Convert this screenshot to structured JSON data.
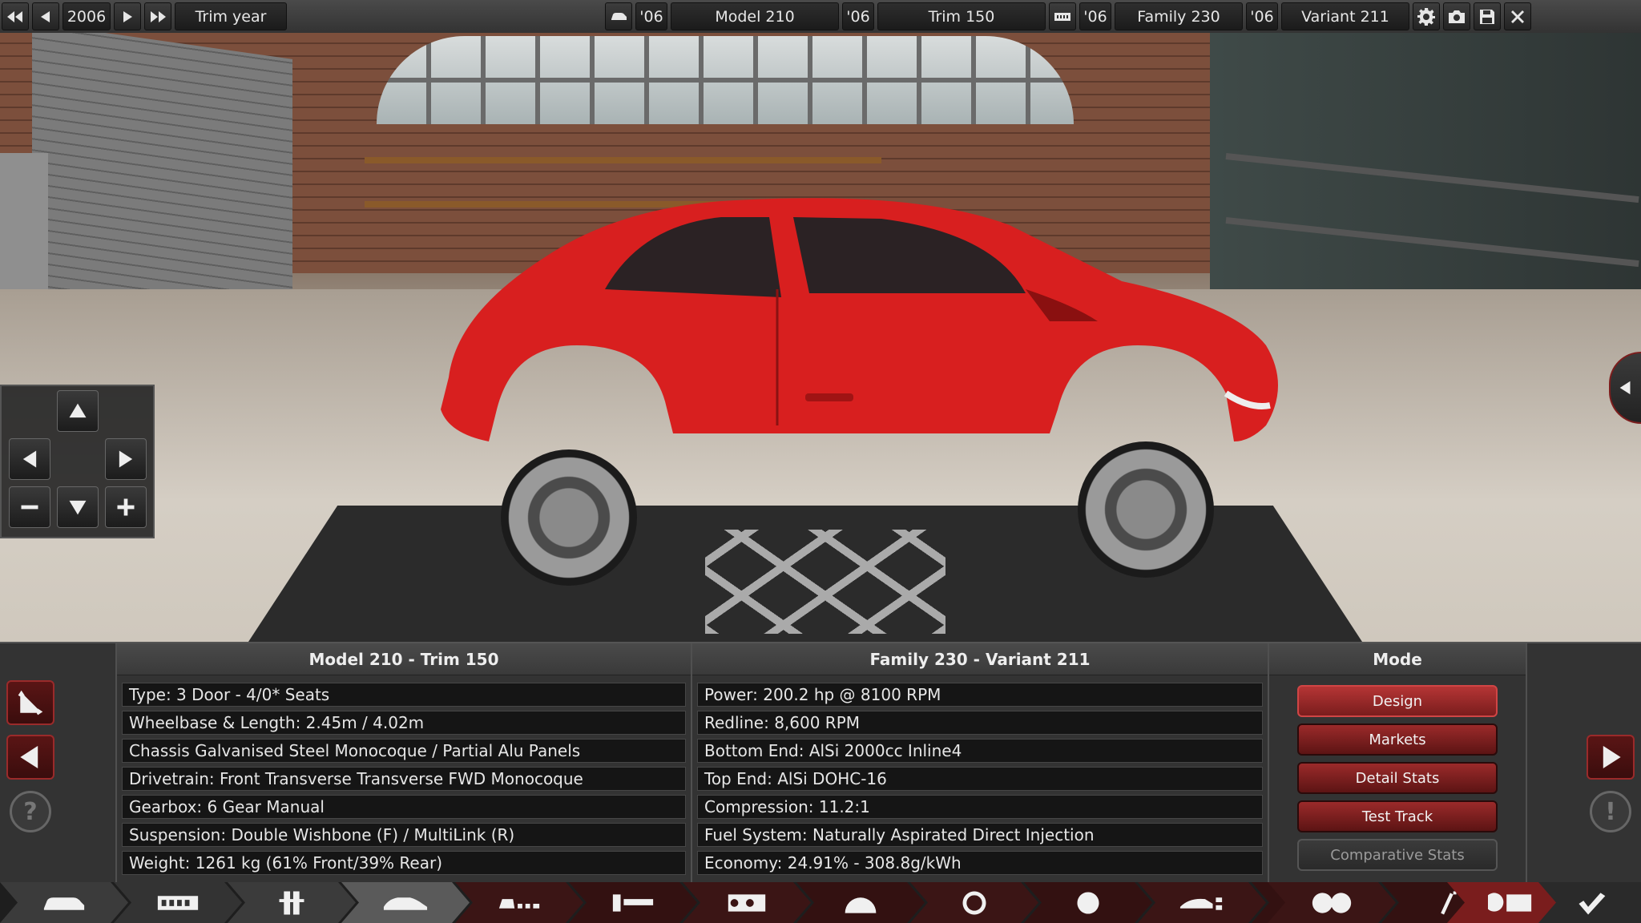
{
  "topbar": {
    "year": "2006",
    "trim_year_label": "Trim year",
    "model_year": "'06",
    "model_name": "Model 210",
    "trim_year": "'06",
    "trim_name": "Trim 150",
    "family_year": "'06",
    "family_name": "Family 230",
    "variant_year": "'06",
    "variant_name": "Variant 211"
  },
  "car_panel": {
    "title": "Model 210 - Trim 150",
    "rows": [
      "Type: 3 Door - 4/0* Seats",
      "Wheelbase & Length: 2.45m / 4.02m",
      "Chassis Galvanised Steel Monocoque / Partial Alu Panels",
      "Drivetrain: Front Transverse Transverse FWD Monocoque",
      "Gearbox: 6 Gear Manual",
      "Suspension: Double Wishbone (F) / MultiLink (R)",
      "Weight: 1261 kg (61% Front/39% Rear)"
    ]
  },
  "engine_panel": {
    "title": "Family 230 - Variant 211",
    "rows": [
      "Power: 200.2 hp @ 8100 RPM",
      "Redline:  8,600 RPM",
      "Bottom End: AlSi 2000cc Inline4",
      "Top End: AlSi DOHC-16",
      "Compression: 11.2:1",
      "Fuel System: Naturally Aspirated Direct Injection",
      "Economy: 24.91% - 308.8g/kWh"
    ]
  },
  "mode_panel": {
    "title": "Mode",
    "buttons": [
      "Design",
      "Markets",
      "Detail Stats",
      "Test Track",
      "Comparative Stats"
    ]
  },
  "colors": {
    "accent_red": "#9b2a2a",
    "car_red": "#d81f1f",
    "panel_bg": "#333333"
  }
}
